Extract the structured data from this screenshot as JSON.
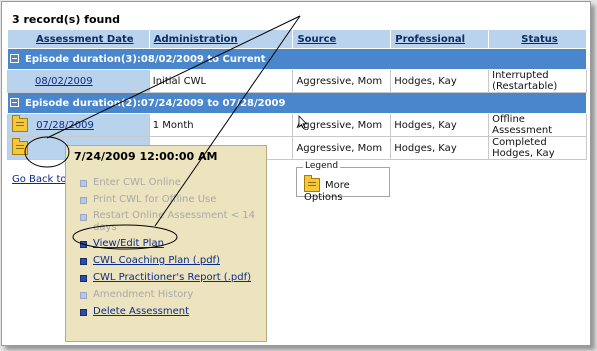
{
  "records_found": "3 record(s) found",
  "columns": {
    "assessment_date": "Assessment Date",
    "administration": "Administration",
    "source": "Source",
    "professional": "Professional",
    "status": "Status"
  },
  "episodes": [
    {
      "label": "Episode duration(3):08/02/2009 to Current",
      "rows": [
        {
          "date": "08/02/2009",
          "administration": "Initial CWL",
          "source": "Aggressive, Mom",
          "professional": "Hodges, Kay",
          "status": "Interrupted (Restartable)"
        }
      ]
    },
    {
      "label": "Episode duration(2):07/24/2009 to 07/28/2009",
      "rows": [
        {
          "date": "07/28/2009",
          "administration": "1 Month",
          "source": "Aggressive, Mom",
          "professional": "Hodges, Kay",
          "status": "Offline Assessment"
        },
        {
          "date": "",
          "administration": "",
          "source": "Aggressive, Mom",
          "professional": "Hodges, Kay",
          "status": "Completed Hodges, Kay"
        }
      ]
    }
  ],
  "go_back_label": "Go Back to",
  "popup": {
    "title": "7/24/2009 12:00:00 AM",
    "items": [
      {
        "label": "Enter CWL Online",
        "enabled": false
      },
      {
        "label": "Print CWL for Offline Use",
        "enabled": false
      },
      {
        "label": "Restart Online Assessment < 14 days",
        "enabled": false
      },
      {
        "label": "View/Edit Plan",
        "enabled": true
      },
      {
        "label": "CWL Coaching Plan (.pdf)",
        "enabled": true
      },
      {
        "label": "CWL Practitioner's Report (.pdf)",
        "enabled": true
      },
      {
        "label": "Amendment History",
        "enabled": false
      },
      {
        "label": "Delete Assessment",
        "enabled": true
      }
    ]
  },
  "legend": {
    "title": "Legend",
    "item_label": "More Options",
    "item_icon": "folder-icon"
  },
  "colors": {
    "header_bg": "#b9d3ec",
    "episode_bg": "#4a86cc",
    "popup_bg": "#ece3bf",
    "link": "#0b2b8a"
  }
}
